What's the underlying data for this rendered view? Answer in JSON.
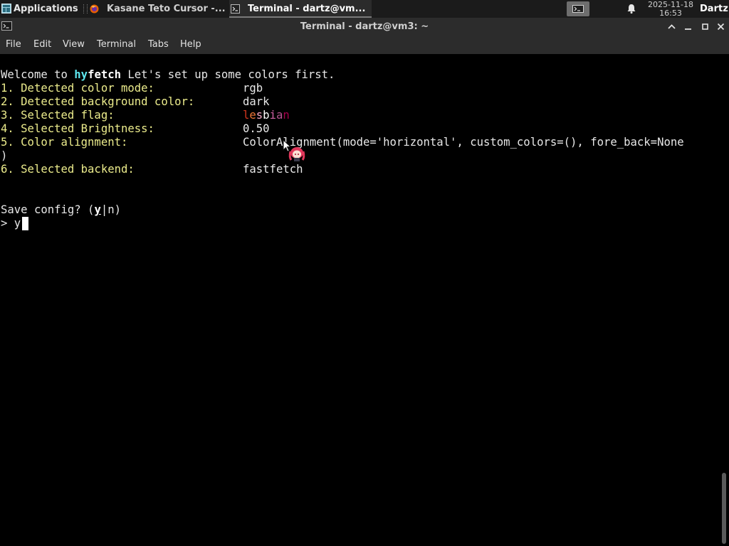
{
  "panel": {
    "applications_label": "Applications",
    "tasks": [
      {
        "label": "Kasane Teto Cursor -...",
        "icon": "firefox-icon"
      },
      {
        "label": "Terminal - dartz@vm...",
        "icon": "terminal-icon"
      }
    ],
    "clock": {
      "date": "2025-11-18",
      "time": "16:53"
    },
    "user": "Dartz"
  },
  "window": {
    "title": "Terminal - dartz@vm3: ~"
  },
  "menu": [
    "File",
    "Edit",
    "View",
    "Terminal",
    "Tabs",
    "Help"
  ],
  "terminal": {
    "welcome": {
      "prefix": "Welcome to ",
      "hy": "hy",
      "fetch": "fetch",
      "suffix": " Let's set up some colors first."
    },
    "rows": [
      {
        "label": "1. Detected color mode:",
        "value": "rgb"
      },
      {
        "label": "2. Detected background color:",
        "value": "dark"
      },
      {
        "label": "3. Selected flag:",
        "value": "lesbian"
      },
      {
        "label": "4. Selected Brightness:",
        "value": "0.50"
      },
      {
        "label": "5. Color alignment:",
        "value": "ColorAlignment(mode='horizontal', custom_colors=(), fore_back=None"
      },
      {
        "label": "6. Selected backend:",
        "value": "fastfetch"
      }
    ],
    "wrap_line": ")",
    "save_prompt": {
      "prefix": "Save config? (",
      "yes": "y",
      "sep": "|",
      "no": "n",
      "suffix": ")"
    },
    "input_prompt": "> ",
    "input_value": "y",
    "flag_colors": [
      "#d5361d",
      "#ef7737",
      "#f7a8c5",
      "#ffffff",
      "#d262a6",
      "#b75592",
      "#a5004b"
    ]
  },
  "colors": {
    "panel_bg": "#1b1b1b",
    "titlebar_bg": "#2c2c2c",
    "term_bg": "#000000",
    "label_yellow": "#ecec8c",
    "hy_cyan": "#5ee6ee"
  }
}
